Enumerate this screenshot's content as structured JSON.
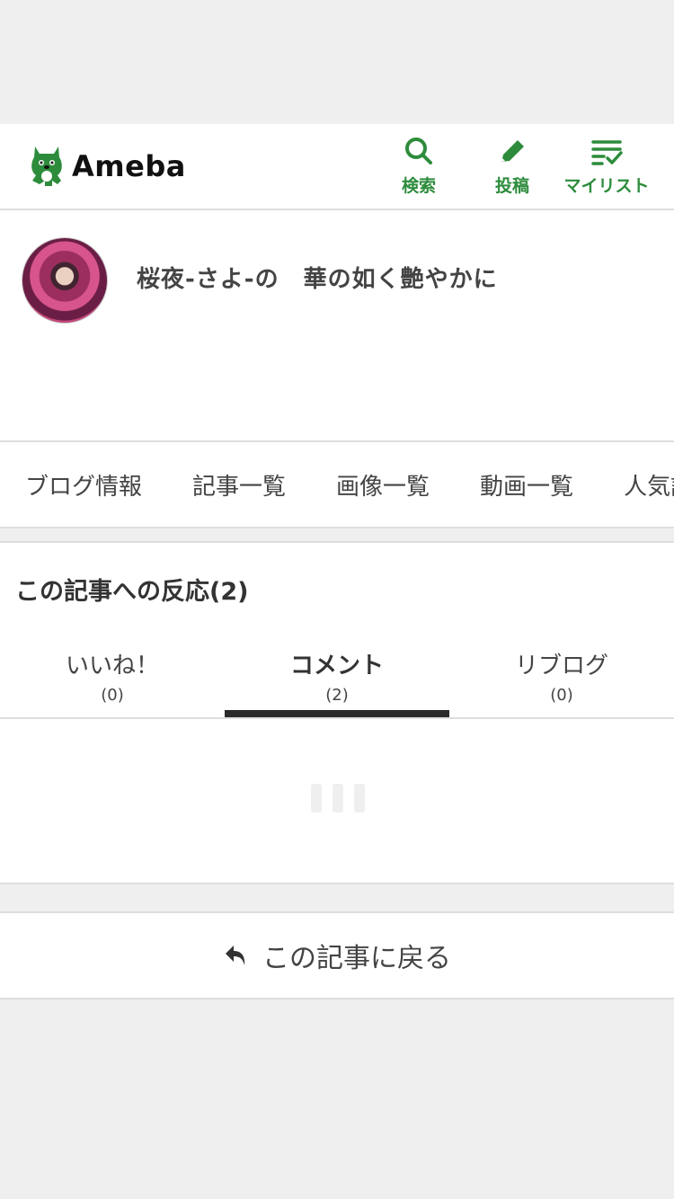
{
  "header": {
    "logo_text": "Ameba",
    "nav": [
      {
        "label": "検索",
        "icon": "search-icon"
      },
      {
        "label": "投稿",
        "icon": "pencil-icon"
      },
      {
        "label": "マイリスト",
        "icon": "mylist-icon"
      }
    ],
    "accent_color": "#2d8c3c"
  },
  "blog": {
    "title": "桜夜-さよ-の　華の如く艶やかに",
    "avatar_icon": "user-avatar"
  },
  "blog_tabs": [
    "ブログ情報",
    "記事一覧",
    "画像一覧",
    "動画一覧",
    "人気記事"
  ],
  "reactions": {
    "title": "この記事への反応(2)",
    "tabs": [
      {
        "label": "いいね！",
        "count": "(0)"
      },
      {
        "label": "コメント",
        "count": "(2)"
      },
      {
        "label": "リブログ",
        "count": "(0)"
      }
    ],
    "active_tab": "コメント"
  },
  "back_button": {
    "label": "この記事に戻る",
    "icon": "reply-arrow-icon"
  }
}
